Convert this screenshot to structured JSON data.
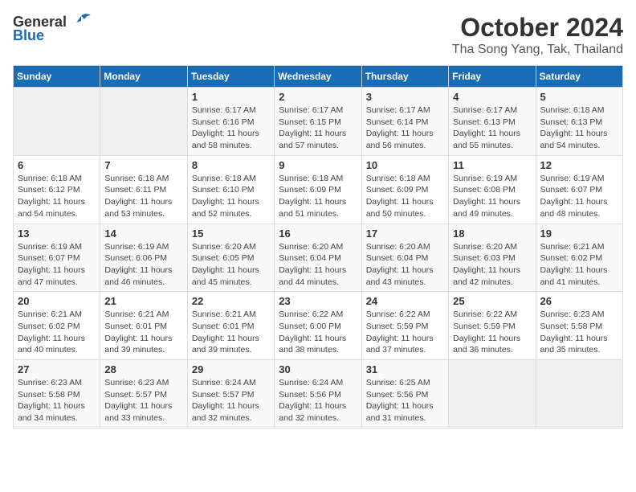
{
  "logo": {
    "general": "General",
    "blue": "Blue"
  },
  "title": {
    "month": "October 2024",
    "location": "Tha Song Yang, Tak, Thailand"
  },
  "weekdays": [
    "Sunday",
    "Monday",
    "Tuesday",
    "Wednesday",
    "Thursday",
    "Friday",
    "Saturday"
  ],
  "weeks": [
    [
      {
        "day": "",
        "info": ""
      },
      {
        "day": "",
        "info": ""
      },
      {
        "day": "1",
        "info": "Sunrise: 6:17 AM\nSunset: 6:16 PM\nDaylight: 11 hours\nand 58 minutes."
      },
      {
        "day": "2",
        "info": "Sunrise: 6:17 AM\nSunset: 6:15 PM\nDaylight: 11 hours\nand 57 minutes."
      },
      {
        "day": "3",
        "info": "Sunrise: 6:17 AM\nSunset: 6:14 PM\nDaylight: 11 hours\nand 56 minutes."
      },
      {
        "day": "4",
        "info": "Sunrise: 6:17 AM\nSunset: 6:13 PM\nDaylight: 11 hours\nand 55 minutes."
      },
      {
        "day": "5",
        "info": "Sunrise: 6:18 AM\nSunset: 6:13 PM\nDaylight: 11 hours\nand 54 minutes."
      }
    ],
    [
      {
        "day": "6",
        "info": "Sunrise: 6:18 AM\nSunset: 6:12 PM\nDaylight: 11 hours\nand 54 minutes."
      },
      {
        "day": "7",
        "info": "Sunrise: 6:18 AM\nSunset: 6:11 PM\nDaylight: 11 hours\nand 53 minutes."
      },
      {
        "day": "8",
        "info": "Sunrise: 6:18 AM\nSunset: 6:10 PM\nDaylight: 11 hours\nand 52 minutes."
      },
      {
        "day": "9",
        "info": "Sunrise: 6:18 AM\nSunset: 6:09 PM\nDaylight: 11 hours\nand 51 minutes."
      },
      {
        "day": "10",
        "info": "Sunrise: 6:18 AM\nSunset: 6:09 PM\nDaylight: 11 hours\nand 50 minutes."
      },
      {
        "day": "11",
        "info": "Sunrise: 6:19 AM\nSunset: 6:08 PM\nDaylight: 11 hours\nand 49 minutes."
      },
      {
        "day": "12",
        "info": "Sunrise: 6:19 AM\nSunset: 6:07 PM\nDaylight: 11 hours\nand 48 minutes."
      }
    ],
    [
      {
        "day": "13",
        "info": "Sunrise: 6:19 AM\nSunset: 6:07 PM\nDaylight: 11 hours\nand 47 minutes."
      },
      {
        "day": "14",
        "info": "Sunrise: 6:19 AM\nSunset: 6:06 PM\nDaylight: 11 hours\nand 46 minutes."
      },
      {
        "day": "15",
        "info": "Sunrise: 6:20 AM\nSunset: 6:05 PM\nDaylight: 11 hours\nand 45 minutes."
      },
      {
        "day": "16",
        "info": "Sunrise: 6:20 AM\nSunset: 6:04 PM\nDaylight: 11 hours\nand 44 minutes."
      },
      {
        "day": "17",
        "info": "Sunrise: 6:20 AM\nSunset: 6:04 PM\nDaylight: 11 hours\nand 43 minutes."
      },
      {
        "day": "18",
        "info": "Sunrise: 6:20 AM\nSunset: 6:03 PM\nDaylight: 11 hours\nand 42 minutes."
      },
      {
        "day": "19",
        "info": "Sunrise: 6:21 AM\nSunset: 6:02 PM\nDaylight: 11 hours\nand 41 minutes."
      }
    ],
    [
      {
        "day": "20",
        "info": "Sunrise: 6:21 AM\nSunset: 6:02 PM\nDaylight: 11 hours\nand 40 minutes."
      },
      {
        "day": "21",
        "info": "Sunrise: 6:21 AM\nSunset: 6:01 PM\nDaylight: 11 hours\nand 39 minutes."
      },
      {
        "day": "22",
        "info": "Sunrise: 6:21 AM\nSunset: 6:01 PM\nDaylight: 11 hours\nand 39 minutes."
      },
      {
        "day": "23",
        "info": "Sunrise: 6:22 AM\nSunset: 6:00 PM\nDaylight: 11 hours\nand 38 minutes."
      },
      {
        "day": "24",
        "info": "Sunrise: 6:22 AM\nSunset: 5:59 PM\nDaylight: 11 hours\nand 37 minutes."
      },
      {
        "day": "25",
        "info": "Sunrise: 6:22 AM\nSunset: 5:59 PM\nDaylight: 11 hours\nand 36 minutes."
      },
      {
        "day": "26",
        "info": "Sunrise: 6:23 AM\nSunset: 5:58 PM\nDaylight: 11 hours\nand 35 minutes."
      }
    ],
    [
      {
        "day": "27",
        "info": "Sunrise: 6:23 AM\nSunset: 5:58 PM\nDaylight: 11 hours\nand 34 minutes."
      },
      {
        "day": "28",
        "info": "Sunrise: 6:23 AM\nSunset: 5:57 PM\nDaylight: 11 hours\nand 33 minutes."
      },
      {
        "day": "29",
        "info": "Sunrise: 6:24 AM\nSunset: 5:57 PM\nDaylight: 11 hours\nand 32 minutes."
      },
      {
        "day": "30",
        "info": "Sunrise: 6:24 AM\nSunset: 5:56 PM\nDaylight: 11 hours\nand 32 minutes."
      },
      {
        "day": "31",
        "info": "Sunrise: 6:25 AM\nSunset: 5:56 PM\nDaylight: 11 hours\nand 31 minutes."
      },
      {
        "day": "",
        "info": ""
      },
      {
        "day": "",
        "info": ""
      }
    ]
  ]
}
